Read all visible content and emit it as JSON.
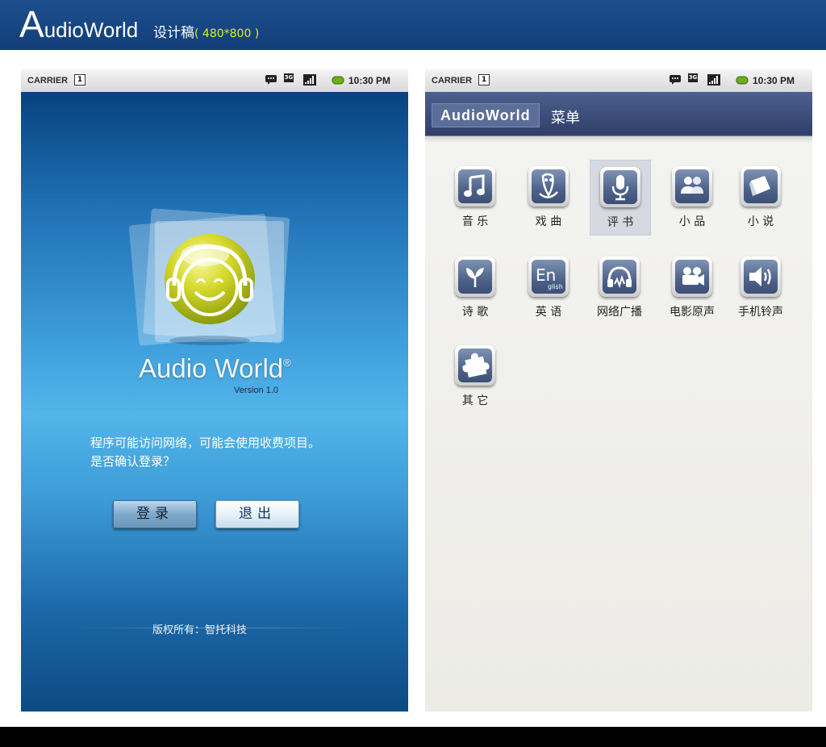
{
  "banner": {
    "title_initial": "A",
    "title_rest": "udioWorld",
    "subtitle": "设计稿",
    "size_note": "( 480*800 )"
  },
  "status_bar": {
    "carrier": "CARRIER",
    "sim_badge": "1",
    "network": "3G",
    "time": "10:30 PM"
  },
  "splash": {
    "app_name": "Audio World",
    "registered_mark": "®",
    "version": "Version 1.0",
    "message_line1": "程序可能访问网络，可能会使用收费项目。",
    "message_line2": "是否确认登录？",
    "login_button": "登录",
    "exit_button": "退出",
    "copyright": "版权所有：智托科技"
  },
  "menu_screen": {
    "header_app": "AudioWorld",
    "header_title": "菜单",
    "selected_index": 2,
    "items": [
      {
        "label": "音 乐",
        "icon": "music-note-icon"
      },
      {
        "label": "戏 曲",
        "icon": "opera-mask-icon"
      },
      {
        "label": "评 书",
        "icon": "microphone-icon"
      },
      {
        "label": "小 品",
        "icon": "people-icon"
      },
      {
        "label": "小 说",
        "icon": "book-pages-icon"
      },
      {
        "label": "诗 歌",
        "icon": "leaf-icon"
      },
      {
        "label": "英 语",
        "icon": "english-icon",
        "glyph": "En",
        "glyph_sub": "glish"
      },
      {
        "label": "网络广播",
        "icon": "headphones-icon"
      },
      {
        "label": "电影原声",
        "icon": "film-camera-icon"
      },
      {
        "label": "手机铃声",
        "icon": "speaker-icon"
      },
      {
        "label": "其 它",
        "icon": "puzzle-piece-icon"
      }
    ]
  }
}
